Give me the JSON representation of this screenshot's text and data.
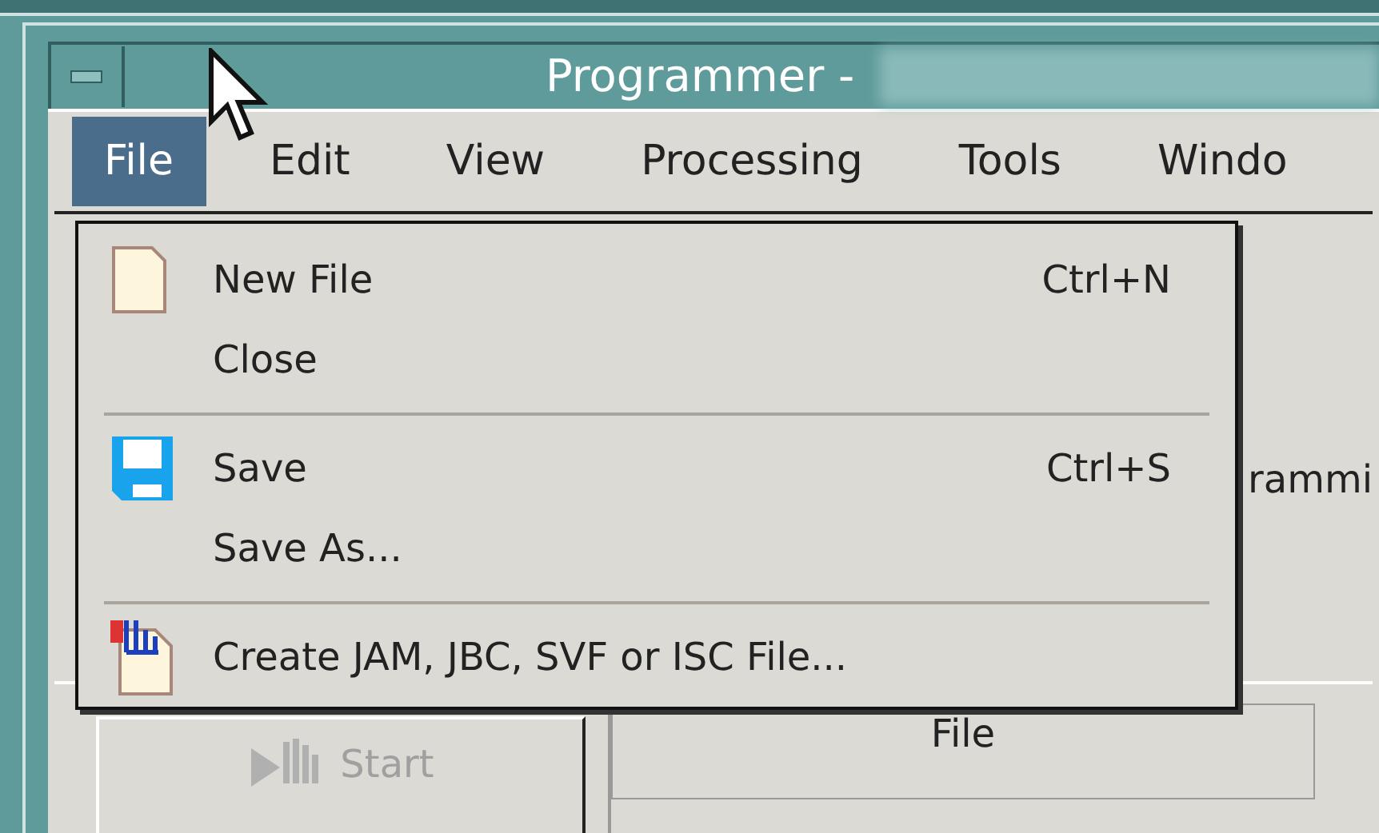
{
  "window": {
    "title": "Programmer -"
  },
  "menu_bar": [
    {
      "label": "File",
      "selected": true
    },
    {
      "label": "Edit",
      "selected": false
    },
    {
      "label": "View",
      "selected": false
    },
    {
      "label": "Processing",
      "selected": false
    },
    {
      "label": "Tools",
      "selected": false
    },
    {
      "label": "Windo",
      "selected": false
    }
  ],
  "file_menu": [
    {
      "kind": "item",
      "label": "New File",
      "shortcut": "Ctrl+N"
    },
    {
      "kind": "item",
      "label": "Close"
    },
    {
      "kind": "separator"
    },
    {
      "kind": "item",
      "label": "Save",
      "shortcut": "Ctrl+S"
    },
    {
      "kind": "item",
      "label": "Save As..."
    },
    {
      "kind": "separator"
    },
    {
      "kind": "item",
      "label": "Create JAM, JBC, SVF or ISC File..."
    }
  ],
  "background": {
    "mode_label": "rammi",
    "start_button": {
      "label": "Start",
      "disabled": true
    },
    "table": {
      "columns": [
        "File"
      ]
    }
  }
}
